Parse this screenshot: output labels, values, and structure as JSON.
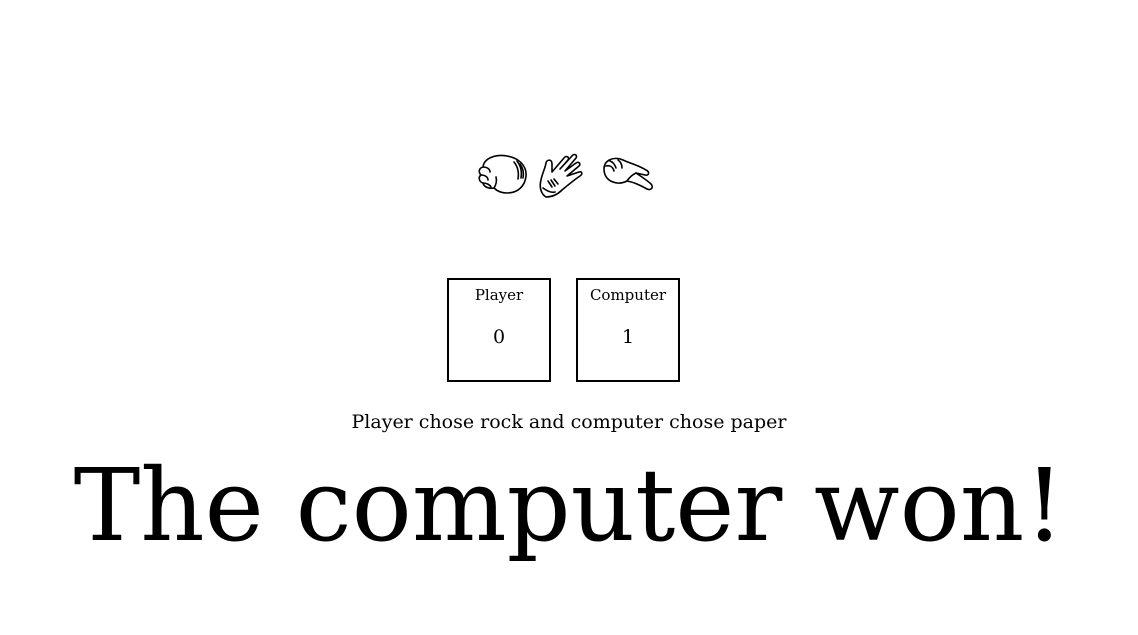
{
  "choices": [
    {
      "name": "rock",
      "icon": "rock-fist-icon"
    },
    {
      "name": "paper",
      "icon": "paper-hand-icon"
    },
    {
      "name": "scissors",
      "icon": "scissors-hand-icon"
    }
  ],
  "scoreboard": {
    "player": {
      "label": "Player",
      "score": "0"
    },
    "computer": {
      "label": "Computer",
      "score": "1"
    }
  },
  "result": {
    "message": "Player chose rock and computer chose paper",
    "winner": "The computer won!"
  }
}
